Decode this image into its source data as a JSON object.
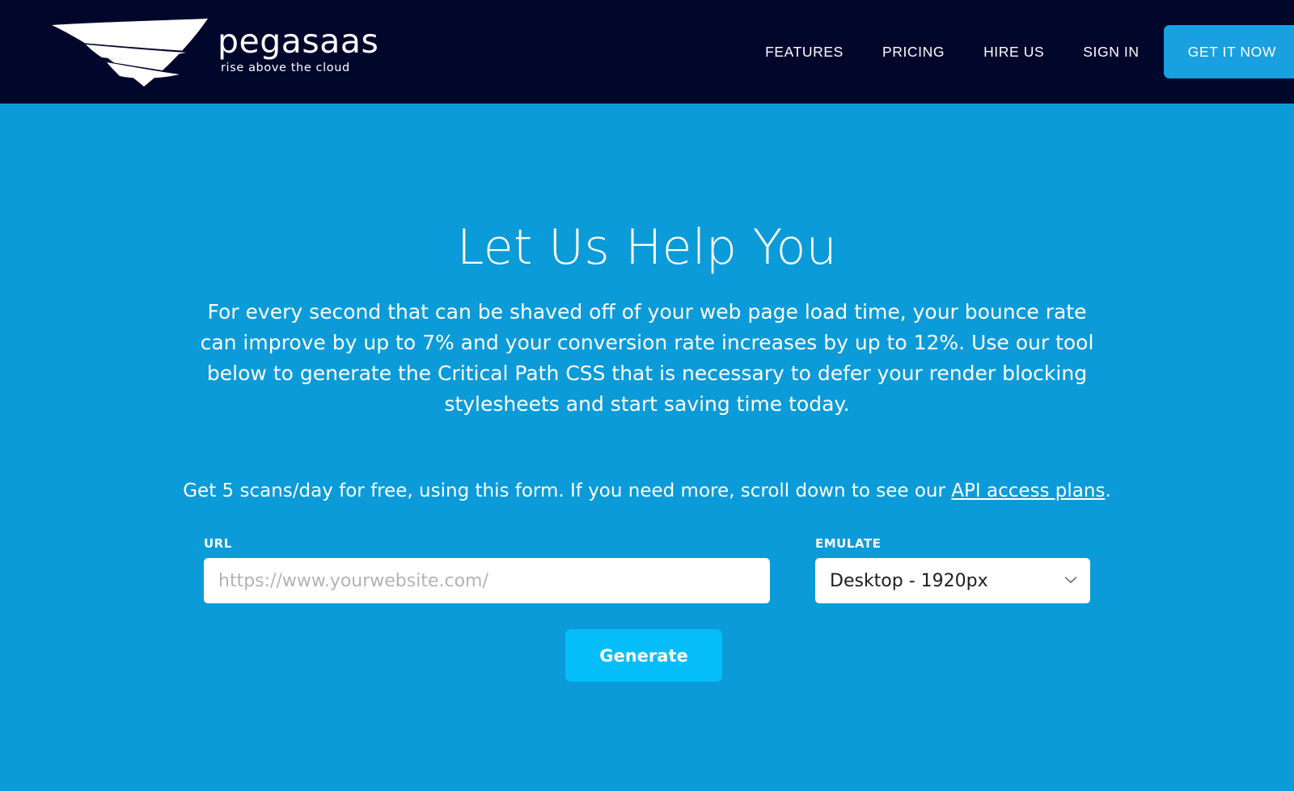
{
  "header": {
    "logo": {
      "icon": "pegasus-wing-logo",
      "wordmark": "pegasaas",
      "tagline": "rise above the cloud"
    },
    "nav": [
      {
        "label": "FEATURES"
      },
      {
        "label": "PRICING"
      },
      {
        "label": "HIRE US"
      },
      {
        "label": "SIGN IN"
      }
    ],
    "cta_label": "GET IT NOW",
    "colors": {
      "background": "#01062b",
      "cta_background": "#18a0e0"
    }
  },
  "hero": {
    "title": "Let Us Help You",
    "paragraph": "For every second that can be shaved off of your web page load time, your bounce rate can improve by up to 7% and your conversion rate increases by up to 12%. Use our tool below to generate the Critical Path CSS that is necessary to defer your render blocking stylesheets and start saving time today.",
    "note_before": "Get 5 scans/day for free, using this form. If you need more, scroll down to see our ",
    "note_link": "API access plans",
    "note_after": ".",
    "background_color": "#0b9bd8"
  },
  "form": {
    "url_field": {
      "label": "URL",
      "placeholder": "https://www.yourwebsite.com/",
      "value": ""
    },
    "emulate_field": {
      "label": "EMULATE",
      "selected": "Desktop - 1920px",
      "chevron_icon": "chevron-down-icon",
      "options": [
        "Desktop - 1920px"
      ]
    },
    "generate_label": "Generate",
    "generate_color": "#05bdf8"
  }
}
